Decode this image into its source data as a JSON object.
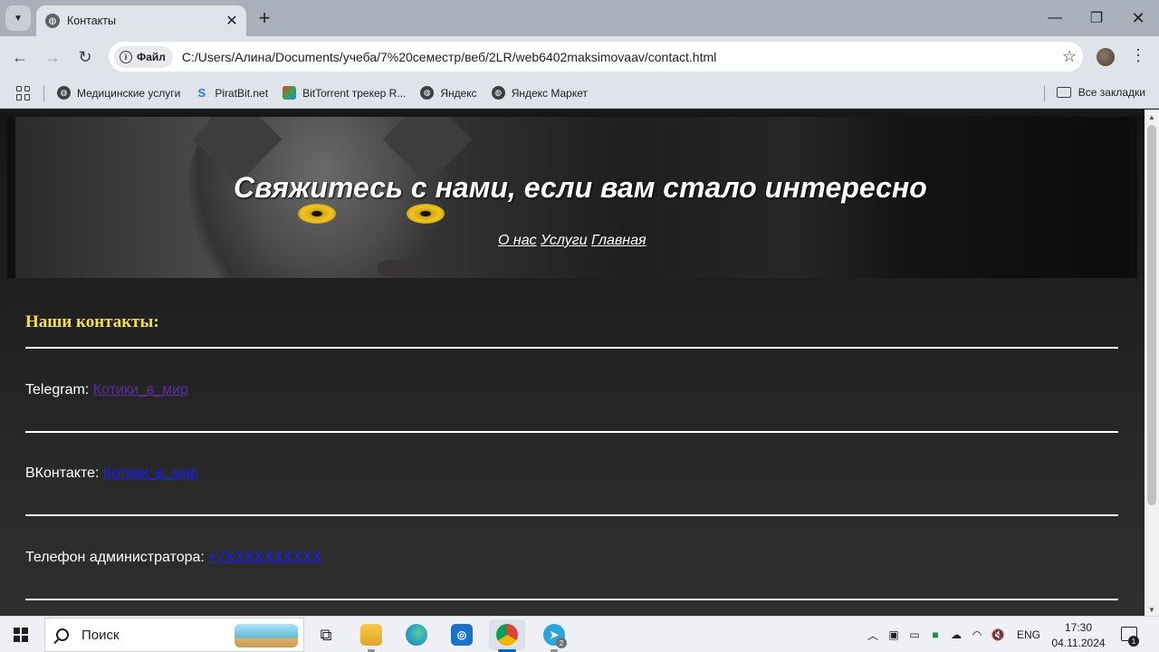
{
  "browser": {
    "tab_title": "Контакты",
    "address_chip": "Файл",
    "url": "C:/Users/Алина/Documents/учеба/7%20семестр/веб/2LR/web6402maksimovaav/contact.html",
    "bookmarks": [
      {
        "label": "Медицинские услуги",
        "icon": "globe-icon"
      },
      {
        "label": "PiratBit.net",
        "icon": "piratbit-icon"
      },
      {
        "label": "BitTorrent трекер R...",
        "icon": "bittorrent-icon"
      },
      {
        "label": "Яндекс",
        "icon": "globe-icon"
      },
      {
        "label": "Яндекс Маркет",
        "icon": "globe-icon"
      }
    ],
    "all_bookmarks": "Все закладки"
  },
  "page": {
    "header_title": "Свяжитесь с нами, если вам стало интересно",
    "nav": [
      "О нас",
      "Услуги",
      "Главная"
    ],
    "contacts_heading": "Наши контакты:",
    "contacts": [
      {
        "label": "Telegram:",
        "link": "Котики_в_мир",
        "link_color": "#5b2aa0"
      },
      {
        "label": "ВКонтакте:",
        "link": "Котики_в_мир",
        "link_color": "#1a1aff"
      },
      {
        "label": "Телефон администратора:",
        "link": "+7XXXXXXXXXX",
        "link_color": "#1a1aff"
      }
    ],
    "colors": {
      "heading": "#f4e04d",
      "text": "#ffffff",
      "background": "#222222"
    }
  },
  "taskbar": {
    "search_placeholder": "Поиск",
    "language": "ENG",
    "time": "17:30",
    "date": "04.11.2024",
    "notification_count": "1",
    "telegram_badge": "2"
  }
}
